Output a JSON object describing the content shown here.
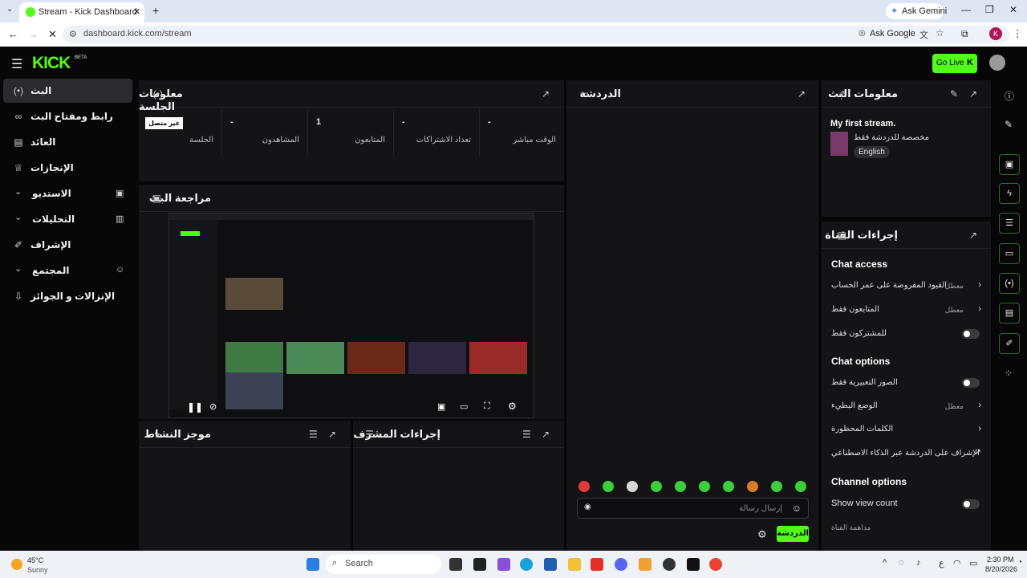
{
  "browser": {
    "tab_title": "Stream - Kick Dashboard",
    "ask_gemini": "Ask Gemini",
    "url": "dashboard.kick.com/stream",
    "ask_google": "Ask Google",
    "profile_initial": "K"
  },
  "topbar": {
    "logo": "KICK",
    "logo_badge": "BETA",
    "go_live": "Go Live"
  },
  "sidebar": {
    "items": [
      {
        "label": "البث",
        "icon": "broadcast-icon"
      },
      {
        "label": "رابط ومفتاح البث",
        "icon": "link-icon"
      },
      {
        "label": "العائد",
        "icon": "revenue-icon"
      },
      {
        "label": "الإنجازات",
        "icon": "trophy-icon"
      },
      {
        "label": "الاستديو",
        "icon": "studio-icon"
      },
      {
        "label": "التحليلات",
        "icon": "analytics-icon"
      },
      {
        "label": "الإشراف",
        "icon": "wrench-icon"
      },
      {
        "label": "المجتمع",
        "icon": "community-icon"
      },
      {
        "label": "الإنزالات و الجوائز",
        "icon": "drops-icon"
      }
    ]
  },
  "session": {
    "title": "معلومات الجلسة",
    "badge": "غير متصل",
    "stats": [
      {
        "value": "-",
        "label": "الجلسة"
      },
      {
        "value": "-",
        "label": "المشاهدون"
      },
      {
        "value": "1",
        "label": "المتابعون"
      },
      {
        "value": "-",
        "label": "تعداد الاشتراكات"
      },
      {
        "value": "-",
        "label": "الوقت مباشر"
      }
    ]
  },
  "preview": {
    "title": "مراجعة البث"
  },
  "activity": {
    "title": "موجز النشاط"
  },
  "moderator": {
    "title": "إجراءات المشرف"
  },
  "chat": {
    "title": "الدردشة",
    "placeholder": "إرسال رسالة",
    "send": "الدردشة"
  },
  "stream_info": {
    "title": "معلومات البث",
    "stream_title": "My first stream.",
    "category": "مخصصة للدردشة فقط",
    "language": "English"
  },
  "channel_actions": {
    "title": "إجراءات القناة",
    "chat_access": "Chat access",
    "account_age": "القيود المفروضة على عمر الحساب",
    "account_age_val": "معطل",
    "followers_only": "المتابعون فقط",
    "followers_only_val": "معطل",
    "subscribers_only": "للمشتركون فقط",
    "chat_options": "Chat options",
    "emotes_only": "الصور التعبيرية فقط",
    "slow_mode": "الوضع البطيء",
    "slow_mode_val": "معطل",
    "banned_words": "الكلمات المحظورة",
    "ai_moderation": "الإشراف على الدردشة عبر الذكاء الاصطناعي",
    "channel_options": "Channel options",
    "show_view_count": "Show view count",
    "channel_nuke": "مداهمة القناة"
  },
  "taskbar": {
    "temp": "45°C",
    "weather": "Sunny",
    "search": "Search",
    "time": "2:30 PM",
    "date": "8/20/2026",
    "lang": "ع"
  },
  "colors": {
    "brand": "#53fc18",
    "bg": "#0b0b0c",
    "panel": "#141416"
  }
}
